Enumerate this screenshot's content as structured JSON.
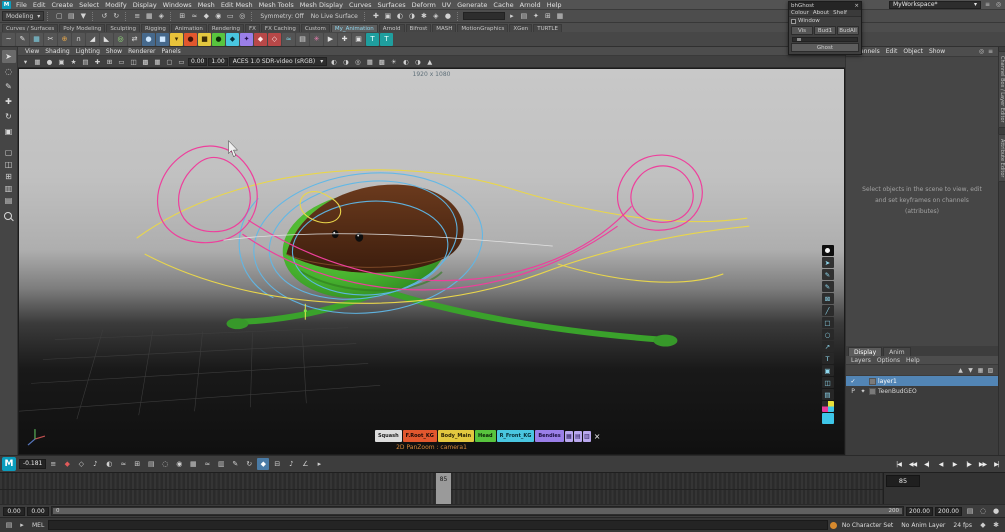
{
  "menubar": {
    "items": [
      "File",
      "Edit",
      "Create",
      "Select",
      "Modify",
      "Display",
      "Windows",
      "Mesh",
      "Edit Mesh",
      "Mesh Tools",
      "Mesh Display",
      "Curves",
      "Surfaces",
      "Deform",
      "UV",
      "Generate",
      "Cache",
      "Arnold",
      "Help"
    ]
  },
  "workspace": {
    "value": "MyWorkspace*"
  },
  "statusline": {
    "menuset": "Modeling",
    "file_icons": [
      {
        "name": "new-scene-icon",
        "glyph": "▢"
      },
      {
        "name": "open-scene-icon",
        "glyph": "▤"
      },
      {
        "name": "save-scene-icon",
        "glyph": "▼"
      }
    ],
    "history_icons": [
      {
        "name": "undo-icon",
        "glyph": "↺"
      },
      {
        "name": "redo-icon",
        "glyph": "↻"
      }
    ],
    "mask_icons": [
      {
        "name": "select-hierarchy-icon",
        "glyph": "≡"
      },
      {
        "name": "select-object-mode-icon",
        "glyph": "▦"
      },
      {
        "name": "select-component-mode-icon",
        "glyph": "◈"
      }
    ],
    "snap_icons": [
      {
        "name": "snap-grid-icon",
        "glyph": "⊞"
      },
      {
        "name": "snap-curve-icon",
        "glyph": "≈"
      },
      {
        "name": "snap-point-icon",
        "glyph": "◆"
      },
      {
        "name": "snap-projected-center-icon",
        "glyph": "◉"
      },
      {
        "name": "snap-view-plane-icon",
        "glyph": "▭"
      },
      {
        "name": "make-live-icon",
        "glyph": "◎"
      }
    ],
    "symmetry": "Symmetry: Off",
    "live_surface": "No Live Surface",
    "render_icons": [
      {
        "name": "construction-history-icon",
        "glyph": "✚"
      },
      {
        "name": "open-render-view-icon",
        "glyph": "▣"
      },
      {
        "name": "render-current-frame-icon",
        "glyph": "◐"
      },
      {
        "name": "ipr-render-icon",
        "glyph": "◑"
      },
      {
        "name": "render-settings-icon",
        "glyph": "✱"
      },
      {
        "name": "hypershade-icon",
        "glyph": "◈"
      },
      {
        "name": "arnold-renderview-icon",
        "glyph": "●"
      }
    ],
    "right_icons": [
      {
        "name": "selection-field-icon",
        "glyph": "▸"
      },
      {
        "name": "sort-icon",
        "glyph": "▤"
      },
      {
        "name": "highlight-selection-icon",
        "glyph": "✦"
      },
      {
        "name": "grid-toggle-icon",
        "glyph": "⊞"
      },
      {
        "name": "heads-up-display-icon",
        "glyph": "▦"
      }
    ]
  },
  "shelf": {
    "tabs": [
      {
        "label": "Curves / Surfaces",
        "cls": ""
      },
      {
        "label": "Poly Modeling",
        "cls": ""
      },
      {
        "label": "Sculpting",
        "cls": ""
      },
      {
        "label": "Rigging",
        "cls": ""
      },
      {
        "label": "Animation",
        "cls": ""
      },
      {
        "label": "Rendering",
        "cls": ""
      },
      {
        "label": "FX",
        "cls": ""
      },
      {
        "label": "FX Caching",
        "cls": ""
      },
      {
        "label": "Custom",
        "cls": ""
      },
      {
        "label": "My_Animation",
        "cls": "active"
      },
      {
        "label": "Arnold",
        "cls": ""
      },
      {
        "label": "Bifrost",
        "cls": ""
      },
      {
        "label": "MASH",
        "cls": ""
      },
      {
        "label": "MotionGraphics",
        "cls": ""
      },
      {
        "label": "XGen",
        "cls": ""
      },
      {
        "label": "TURTLE",
        "cls": ""
      }
    ],
    "icons": [
      {
        "name": "ep-curve-tool-icon",
        "glyph": "~",
        "color": "#555555",
        "fg": "#e0e0e0"
      },
      {
        "name": "pencil-curve-tool-icon",
        "glyph": "✎",
        "color": "#555555",
        "fg": "#e0e0e0"
      },
      {
        "name": "quad-draw-icon",
        "glyph": "▦",
        "color": "#555555",
        "fg": "#7fd4e8"
      },
      {
        "name": "multi-cut-icon",
        "glyph": "✂",
        "color": "#555555",
        "fg": "#e0e0e0"
      },
      {
        "name": "target-weld-icon",
        "glyph": "⊕",
        "color": "#555555",
        "fg": "#e8a84a"
      },
      {
        "name": "bridge-icon",
        "glyph": "∩",
        "color": "#555555",
        "fg": "#e0e0e0"
      },
      {
        "name": "extrude-icon",
        "glyph": "◢",
        "color": "#555555",
        "fg": "#e0e0e0"
      },
      {
        "name": "bevel-icon",
        "glyph": "◣",
        "color": "#555555",
        "fg": "#e0e0e0"
      },
      {
        "name": "smooth-icon",
        "glyph": "◎",
        "color": "#555555",
        "fg": "#9ae87f"
      },
      {
        "name": "mirror-icon",
        "glyph": "⇄",
        "color": "#555555",
        "fg": "#e0e0e0"
      },
      {
        "name": "sphere-primitive-icon",
        "glyph": "●",
        "color": "#46698c",
        "fg": "#cfe8ff"
      },
      {
        "name": "cube-primitive-icon",
        "glyph": "■",
        "color": "#46698c",
        "fg": "#cfe8ff"
      },
      {
        "name": "squash-control-icon",
        "glyph": "▾",
        "color": "#e8c23a",
        "fg": "#3a2c08"
      },
      {
        "name": "root-control-icon",
        "glyph": "●",
        "color": "#e2572e",
        "fg": "#40140a"
      },
      {
        "name": "body-control-icon",
        "glyph": "■",
        "color": "#e3c83f",
        "fg": "#3a2c08"
      },
      {
        "name": "head-control-icon",
        "glyph": "●",
        "color": "#58c43e",
        "fg": "#0c2c08"
      },
      {
        "name": "front-control-icon",
        "glyph": "◆",
        "color": "#49c6e0",
        "fg": "#08303a"
      },
      {
        "name": "bendies-control-icon",
        "glyph": "✦",
        "color": "#9a7fe8",
        "fg": "#221048"
      },
      {
        "name": "set-key-icon",
        "glyph": "◆",
        "color": "#b84848",
        "fg": "#ffe8e8"
      },
      {
        "name": "delete-key-icon",
        "glyph": "◇",
        "color": "#b84848",
        "fg": "#ffe8e8"
      },
      {
        "name": "graph-editor-icon",
        "glyph": "≈",
        "color": "#555555",
        "fg": "#7fd4e8"
      },
      {
        "name": "dope-sheet-icon",
        "glyph": "▤",
        "color": "#555555",
        "fg": "#e0e0e0"
      },
      {
        "name": "motion-trail-icon",
        "glyph": "✳",
        "color": "#555555",
        "fg": "#e87fb0"
      },
      {
        "name": "playblast-icon",
        "glyph": "▶",
        "color": "#555555",
        "fg": "#e0e0e0"
      },
      {
        "name": "locator-icon",
        "glyph": "✚",
        "color": "#555555",
        "fg": "#e0e0e0"
      },
      {
        "name": "camera-shelf-icon",
        "glyph": "▣",
        "color": "#555555",
        "fg": "#e0e0e0"
      },
      {
        "name": "teal-t-pose-icon",
        "glyph": "T",
        "color": "#1f9e9e",
        "fg": "#eaffff"
      },
      {
        "name": "teal-t-pose-plus-icon",
        "glyph": "T",
        "color": "#1f9e9e",
        "fg": "#eaffff"
      }
    ]
  },
  "toolbox": {
    "tools": [
      {
        "name": "select-tool-icon",
        "glyph": "➤",
        "cls": "active"
      },
      {
        "name": "lasso-tool-icon",
        "glyph": "◌",
        "cls": ""
      },
      {
        "name": "paint-select-tool-icon",
        "glyph": "✎",
        "cls": ""
      },
      {
        "name": "move-tool-icon",
        "glyph": "✚",
        "cls": ""
      },
      {
        "name": "rotate-tool-icon",
        "glyph": "↻",
        "cls": ""
      },
      {
        "name": "scale-tool-icon",
        "glyph": "▣",
        "cls": ""
      }
    ],
    "layouts": [
      {
        "name": "single-pane-layout-icon",
        "glyph": "▢"
      },
      {
        "name": "two-pane-side-layout-icon",
        "glyph": "◫"
      },
      {
        "name": "four-pane-layout-icon",
        "glyph": "⊞"
      },
      {
        "name": "persp-outliner-layout-icon",
        "glyph": "▥"
      },
      {
        "name": "split-pane-layout-icon",
        "glyph": "▤"
      }
    ]
  },
  "panelmenu": {
    "items": [
      "View",
      "Shading",
      "Lighting",
      "Show",
      "Renderer",
      "Panels"
    ]
  },
  "vtoolbar": {
    "left_icons": [
      {
        "name": "viewport-menu-icon",
        "glyph": "▾"
      },
      {
        "name": "select-camera-icon",
        "glyph": "▦"
      },
      {
        "name": "lock-camera-icon",
        "glyph": "●"
      },
      {
        "name": "camera-attributes-icon",
        "glyph": "▣"
      },
      {
        "name": "bookmarks-icon",
        "glyph": "★"
      },
      {
        "name": "image-plane-icon",
        "glyph": "▤"
      },
      {
        "name": "2d-pan-zoom-icon",
        "glyph": "✚"
      },
      {
        "name": "grid-toggle-icon",
        "glyph": "⊞"
      },
      {
        "name": "film-gate-icon",
        "glyph": "▭"
      },
      {
        "name": "resolution-gate-icon",
        "glyph": "◫"
      },
      {
        "name": "gate-mask-icon",
        "glyph": "▩"
      },
      {
        "name": "field-chart-icon",
        "glyph": "▦"
      },
      {
        "name": "safe-action-icon",
        "glyph": "▢"
      },
      {
        "name": "safe-title-icon",
        "glyph": "▭"
      }
    ],
    "exposure": "0.00",
    "gamma": "1.00",
    "colorspace": "ACES 1.0 SDR-video (sRGB)",
    "right_icons": [
      {
        "name": "exposure-icon",
        "glyph": "◐"
      },
      {
        "name": "gamma-icon",
        "glyph": "◑"
      },
      {
        "name": "xray-icon",
        "glyph": "◎"
      },
      {
        "name": "wireframe-on-shaded-icon",
        "glyph": "▦"
      },
      {
        "name": "textured-mode-icon",
        "glyph": "▩"
      },
      {
        "name": "lighting-mode-icon",
        "glyph": "☀"
      },
      {
        "name": "shadows-icon",
        "glyph": "◐"
      },
      {
        "name": "screen-space-ao-icon",
        "glyph": "◑"
      },
      {
        "name": "anti-aliasing-icon",
        "glyph": "▲"
      }
    ]
  },
  "viewport": {
    "resolution": "1920 x 1080",
    "camera_label": "2D PanZoom : camera1",
    "picker": {
      "buttons": [
        {
          "label": "Squash",
          "color": "#dcdcdc",
          "fg": "#222222"
        },
        {
          "label": "F.Root_KG",
          "color": "#e2572e",
          "fg": "#1a0a06"
        },
        {
          "label": "Body_Main",
          "color": "#e3c83f",
          "fg": "#2a2206"
        },
        {
          "label": "Head",
          "color": "#58c43e",
          "fg": "#0a2406"
        },
        {
          "label": "R_Front_KG",
          "color": "#49c6e0",
          "fg": "#062a32"
        },
        {
          "label": "Bendies",
          "color": "#9a7fe8",
          "fg": "#1c1040"
        }
      ],
      "icons": [
        {
          "name": "picker-grid-icon",
          "glyph": "▦"
        },
        {
          "name": "picker-rows-icon",
          "glyph": "▤"
        },
        {
          "name": "picker-cols-icon",
          "glyph": "▥"
        }
      ],
      "close": "×"
    }
  },
  "bluepencil": {
    "items": [
      {
        "name": "in-view-light-icon",
        "glyph": "",
        "cls": "bulb"
      },
      {
        "name": "bp-select-icon",
        "glyph": "➤",
        "cls": ""
      },
      {
        "name": "bp-pencil-icon",
        "glyph": "✎",
        "cls": ""
      },
      {
        "name": "bp-marker-icon",
        "glyph": "✎",
        "cls": ""
      },
      {
        "name": "bp-eraser-icon",
        "glyph": "⊠",
        "cls": ""
      },
      {
        "name": "bp-line-icon",
        "glyph": "╱",
        "cls": ""
      },
      {
        "name": "bp-rectangle-icon",
        "glyph": "□",
        "cls": ""
      },
      {
        "name": "bp-ellipse-icon",
        "glyph": "○",
        "cls": ""
      },
      {
        "name": "bp-arrow-icon",
        "glyph": "↗",
        "cls": ""
      },
      {
        "name": "bp-text-icon",
        "glyph": "T",
        "cls": ""
      },
      {
        "name": "bp-image-icon",
        "glyph": "▣",
        "cls": ""
      },
      {
        "name": "bp-frame-icon",
        "glyph": "◫",
        "cls": ""
      },
      {
        "name": "bp-layers-icon",
        "glyph": "▤",
        "cls": ""
      },
      {
        "name": "bp-color-wheel-icon",
        "glyph": "",
        "cls": "cmyk"
      },
      {
        "name": "bp-active-color-icon",
        "glyph": "",
        "cls": "bluesq"
      }
    ]
  },
  "rightpanel": {
    "menus": [
      "Channels",
      "Edit",
      "Object",
      "Show"
    ],
    "head_icons": [
      {
        "name": "pin-icon",
        "glyph": "◎"
      },
      {
        "name": "panel-menu-icon",
        "glyph": "≡"
      }
    ],
    "message": "Select objects in the scene to view, edit and set keyframes on channels (attributes)",
    "tabs": [
      {
        "label": "Display",
        "cls": "active"
      },
      {
        "label": "Anim",
        "cls": ""
      }
    ],
    "layer_menus": [
      "Layers",
      "Options",
      "Help"
    ],
    "layer_icons": [
      {
        "name": "move-layer-up-icon",
        "glyph": "▲"
      },
      {
        "name": "move-layer-down-icon",
        "glyph": "▼"
      },
      {
        "name": "new-empty-layer-icon",
        "glyph": "▦"
      },
      {
        "name": "new-layer-from-selected-icon",
        "glyph": "▧"
      }
    ],
    "layers": [
      {
        "vis": "✓",
        "type": "",
        "label": "layer1",
        "cls": "selected"
      },
      {
        "vis": "P",
        "type": "✦",
        "label": "TeenBudGEO",
        "cls": ""
      }
    ]
  },
  "edgetabs": {
    "items": [
      "Channel Box / Layer Editor",
      "Attribute Editor"
    ]
  },
  "ghostwin": {
    "title": "bhGhost",
    "menus": [
      "Colour",
      "About",
      "Shelf"
    ],
    "window_label": "Window",
    "buttons": [
      "Vis",
      "Bud1",
      "BudAll"
    ],
    "ghost_label": "Ghost"
  },
  "playbar": {
    "time_value": "-0.181",
    "icons": [
      {
        "name": "playback-menu-icon",
        "glyph": "≡",
        "cls": ""
      },
      {
        "name": "set-key-icon",
        "glyph": "◆",
        "cls": "red"
      },
      {
        "name": "set-breakdown-icon",
        "glyph": "◇",
        "cls": ""
      },
      {
        "name": "audio-waveform-icon",
        "glyph": "♪",
        "cls": ""
      },
      {
        "name": "ghosting-icon",
        "glyph": "◐",
        "cls": ""
      },
      {
        "name": "motion-trail-icon",
        "glyph": "≈",
        "cls": ""
      },
      {
        "name": "snap-keys-icon",
        "glyph": "⊞",
        "cls": ""
      },
      {
        "name": "buffer-curve-icon",
        "glyph": "▤",
        "cls": ""
      },
      {
        "name": "mute-channel-icon",
        "glyph": "◌",
        "cls": ""
      },
      {
        "name": "character-set-icon",
        "glyph": "◉",
        "cls": ""
      },
      {
        "name": "time-editor-icon",
        "glyph": "▦",
        "cls": ""
      },
      {
        "name": "graph-editor-icon",
        "glyph": "≈",
        "cls": ""
      },
      {
        "name": "dope-sheet-icon",
        "glyph": "▥",
        "cls": ""
      },
      {
        "name": "grease-pencil-icon",
        "glyph": "✎",
        "cls": ""
      },
      {
        "name": "playback-looping-icon",
        "glyph": "↻",
        "cls": ""
      },
      {
        "name": "auto-key-toggle-icon",
        "glyph": "◆",
        "cls": "activeblue"
      },
      {
        "name": "step-snap-icon",
        "glyph": "⊟",
        "cls": ""
      },
      {
        "name": "sound-scrub-icon",
        "glyph": "♪",
        "cls": ""
      },
      {
        "name": "tangent-type-icon",
        "glyph": "∠",
        "cls": ""
      },
      {
        "name": "playback-speed-icon",
        "glyph": "▸",
        "cls": ""
      }
    ],
    "transport": [
      {
        "name": "go-to-start-button",
        "glyph": "|◀"
      },
      {
        "name": "step-back-key-button",
        "glyph": "◀◀"
      },
      {
        "name": "step-back-frame-button",
        "glyph": "◀|"
      },
      {
        "name": "play-backwards-button",
        "glyph": "◀"
      },
      {
        "name": "play-forwards-button",
        "glyph": "▶"
      },
      {
        "name": "step-forward-frame-button",
        "glyph": "|▶"
      },
      {
        "name": "step-forward-key-button",
        "glyph": "▶▶"
      },
      {
        "name": "go-to-end-button",
        "glyph": "▶|"
      }
    ]
  },
  "timeslider": {
    "current_frame": "85"
  },
  "rangerow": {
    "anim_start": "0.00",
    "play_start": "0.00",
    "play_end": "200.00",
    "anim_end": "200.00",
    "bar_start": "0",
    "bar_end": "200",
    "icons": [
      {
        "name": "anim-layer-filter-icon",
        "glyph": "▤"
      },
      {
        "name": "mute-all-icon",
        "glyph": "◌"
      },
      {
        "name": "solo-layer-icon",
        "glyph": "●"
      }
    ]
  },
  "bottombar": {
    "mel_label": "MEL",
    "command_value": "",
    "charset": "No Character Set",
    "anim_layer": "No Anim Layer",
    "fps": "24 fps",
    "icons_left": [
      {
        "name": "script-editor-icon",
        "glyph": "▤"
      },
      {
        "name": "command-line-icon",
        "glyph": "▸"
      }
    ],
    "icons_right": [
      {
        "name": "auto-key-icon",
        "glyph": "◆",
        "cls": "red"
      },
      {
        "name": "anim-prefs-icon",
        "glyph": "✱",
        "cls": ""
      }
    ]
  }
}
